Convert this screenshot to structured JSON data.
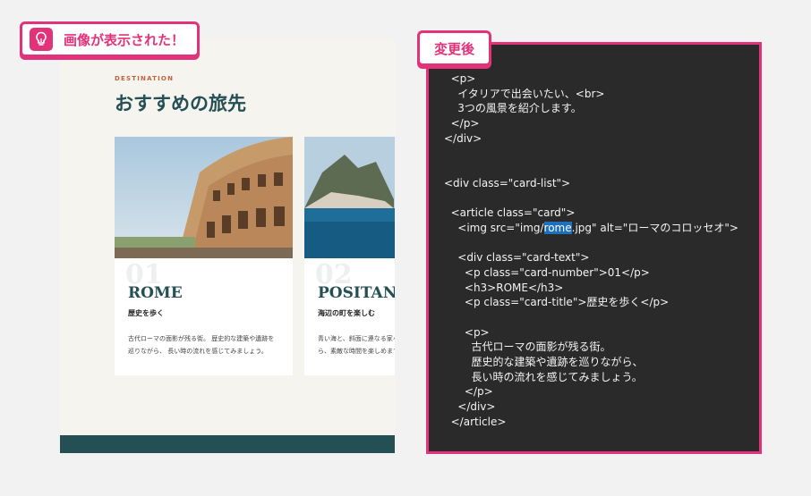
{
  "badges": {
    "image_label": "画像が表示された！",
    "after_label": "変更後",
    "lightbulb_icon": "lightbulb-icon",
    "accent_color": "#e2337a"
  },
  "preview": {
    "eyebrow": "DESTINATION",
    "title": "おすすめの旅先",
    "cards": [
      {
        "number": "01",
        "name": "ROME",
        "subtitle": "歴史を歩く",
        "body": "古代ローマの面影が残る街。 歴史的な建築や遺跡を巡りながら、 長い時の流れを感じてみましょう。"
      },
      {
        "number": "02",
        "name": "POSITANO",
        "subtitle": "海辺の町を楽しむ",
        "body": "青い海と、斜面に連なる家々。美しい景色を眺めながら、素敵な時間を楽しめます。"
      }
    ],
    "colors": {
      "heading": "#244f54",
      "eyebrow": "#c2623a",
      "footer": "#244f54"
    }
  },
  "code": {
    "lines": [
      "  <p>",
      "    イタリアで出会いたい、<br>",
      "    3つの風景を紹介します。",
      "  </p>",
      "</div>",
      "",
      "",
      "<div class=\"card-list\">",
      "",
      "  <article class=\"card\">",
      "    <img src=\"img/rome.jpg\" alt=\"ローマのコロッセオ\">",
      "",
      "    <div class=\"card-text\">",
      "      <p class=\"card-number\">01</p>",
      "      <h3>ROME</h3>",
      "      <p class=\"card-title\">歴史を歩く</p>",
      "",
      "      <p>",
      "        古代ローマの面影が残る街。",
      "        歴史的な建築や遺跡を巡りながら、",
      "        長い時の流れを感じてみましょう。",
      "      </p>",
      "    </div>",
      "  </article>"
    ],
    "highlight_line": 10,
    "highlight_word": "rome"
  }
}
